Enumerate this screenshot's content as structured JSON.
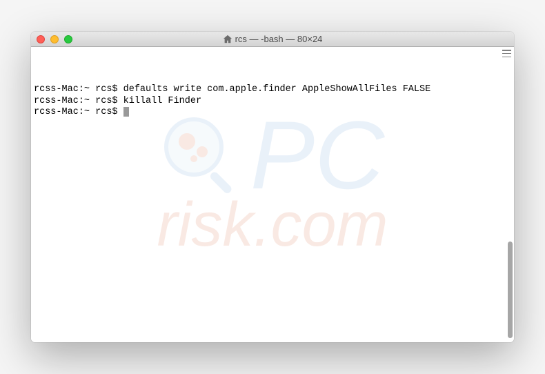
{
  "window": {
    "title": "rcs — -bash — 80×24"
  },
  "terminal": {
    "lines": [
      {
        "prompt": "rcss-Mac:~ rcs$ ",
        "command": "defaults write com.apple.finder AppleShowAllFiles FALSE"
      },
      {
        "prompt": "rcss-Mac:~ rcs$ ",
        "command": "killall Finder"
      },
      {
        "prompt": "rcss-Mac:~ rcs$ ",
        "command": ""
      }
    ]
  },
  "watermark": {
    "pc": "PC",
    "risk": "risk.com"
  }
}
